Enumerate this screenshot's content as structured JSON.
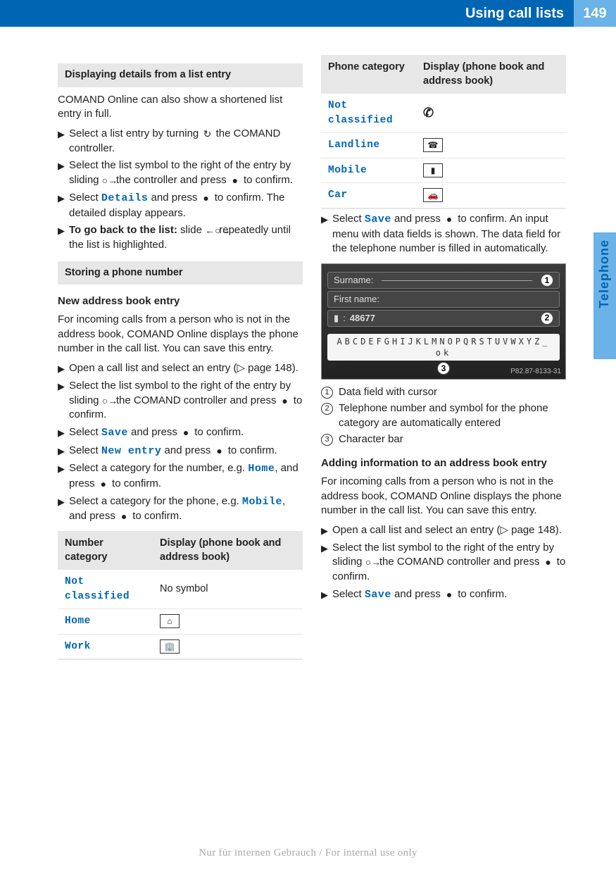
{
  "header": {
    "title": "Using call lists",
    "page_number": "149"
  },
  "side_tab": "Telephone",
  "sec1": {
    "title": "Displaying details from a list entry",
    "intro": "COMAND Online can also show a shortened list entry in full.",
    "steps": [
      {
        "pre": "Select a list entry by turning ",
        "suf": " the COMAND controller."
      },
      {
        "pre": "Select the list symbol to the right of the entry by sliding ",
        "mid": " the controller and press ",
        "suf": " to confirm."
      },
      {
        "pre": "Select ",
        "ui": "Details",
        "mid": " and press ",
        "suf": " to confirm. The detailed display appears."
      },
      {
        "bold": "To go back to the list:",
        "pre": " slide ",
        "suf": " repeatedly until the list is highlighted."
      }
    ]
  },
  "sec2": {
    "title": "Storing a phone number",
    "sub1": "New address book entry",
    "intro": "For incoming calls from a person who is not in the address book, COMAND Online displays the phone number in the call list. You can save this entry.",
    "steps": [
      {
        "txt": "Open a call list and select an entry (▷ page 148)."
      },
      {
        "pre": "Select the list symbol to the right of the entry by sliding ",
        "mid": " the COMAND controller and press ",
        "suf": " to confirm."
      },
      {
        "pre": "Select ",
        "ui": "Save",
        "mid": " and press ",
        "suf": " to confirm."
      },
      {
        "pre": "Select ",
        "ui": "New entry",
        "mid": " and press ",
        "suf": " to confirm."
      },
      {
        "pre": "Select a category for the number, e.g. ",
        "ui": "Home",
        "mid": ", and press ",
        "suf": " to confirm."
      },
      {
        "pre": "Select a category for the phone, e.g. ",
        "ui": "Mobile",
        "mid": ", and press ",
        "suf": " to confirm."
      }
    ]
  },
  "table1": {
    "head": [
      "Number category",
      "Display (phone book and address book)"
    ],
    "rows": [
      {
        "cat": "Not classified",
        "disp": "No symbol",
        "kind": "text"
      },
      {
        "cat": "Home",
        "disp": "home-icon",
        "kind": "icon"
      },
      {
        "cat": "Work",
        "disp": "office-icon",
        "kind": "icon"
      }
    ]
  },
  "table2": {
    "head": [
      "Phone category",
      "Display (phone book and address book)"
    ],
    "rows": [
      {
        "cat": "Not classified",
        "disp": "handset-icon",
        "kind": "bare-icon"
      },
      {
        "cat": "Landline",
        "disp": "landline-icon",
        "kind": "icon"
      },
      {
        "cat": "Mobile",
        "disp": "mobile-icon",
        "kind": "icon"
      },
      {
        "cat": "Car",
        "disp": "car-icon",
        "kind": "icon"
      }
    ]
  },
  "right_step": {
    "pre": "Select ",
    "ui": "Save",
    "mid": " and press ",
    "suf": " to confirm. An input menu with data fields is shown. The data field for the telephone number is filled in automatically."
  },
  "screenshot": {
    "surname_label": "Surname:",
    "firstname_label": "First name:",
    "number": "48677",
    "charbar": "ABCDEFGHIJKLMNOPQRSTUVWXYZ_ ok",
    "tag": "P82.87-8133-31"
  },
  "callouts": [
    "Data field with cursor",
    "Telephone number and symbol for the phone category are automatically entered",
    "Character bar"
  ],
  "sec3": {
    "sub": "Adding information to an address book entry",
    "intro": "For incoming calls from a person who is not in the address book, COMAND Online displays the phone number in the call list. You can save this entry.",
    "steps": [
      {
        "txt": "Open a call list and select an entry (▷ page 148)."
      },
      {
        "pre": "Select the list symbol to the right of the entry by sliding ",
        "mid": " the COMAND controller and press ",
        "suf": " to confirm."
      },
      {
        "pre": "Select ",
        "ui": "Save",
        "mid": " and press ",
        "suf": " to confirm."
      }
    ]
  },
  "footer": "Nur für internen Gebrauch / For internal use only",
  "icons": {
    "turn": "↻",
    "slide_right": "○→",
    "press": "●",
    "slide_both": "←○→",
    "home": "⌂",
    "office": "🏢",
    "handset": "✆",
    "landline": "☎",
    "mobile": "📱",
    "car": "🚗"
  }
}
